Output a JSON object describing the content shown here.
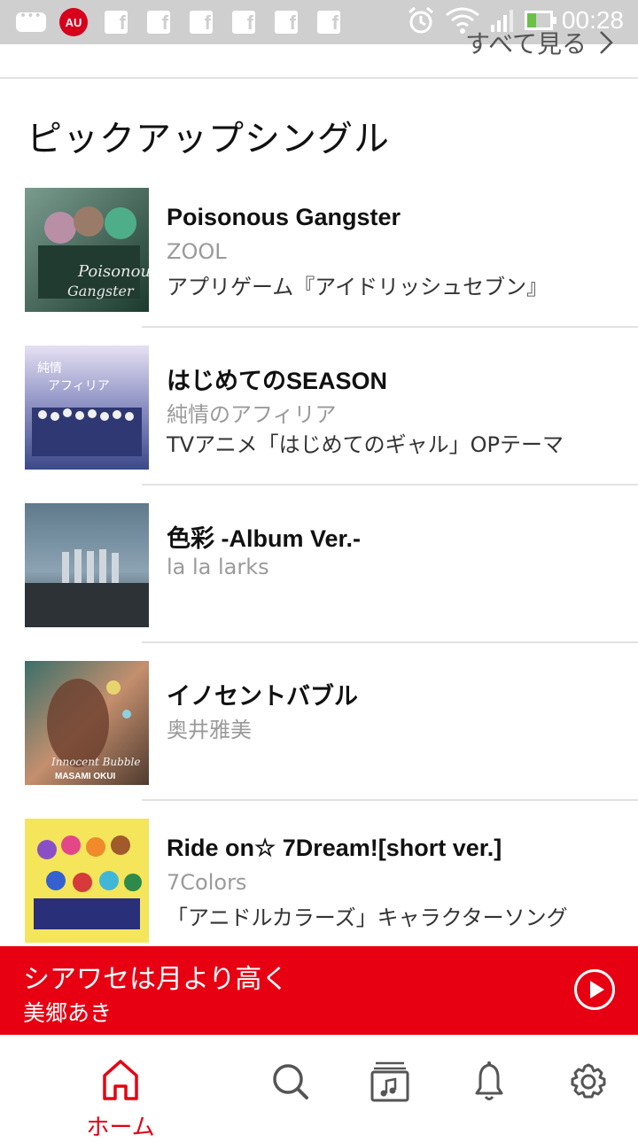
{
  "status_bar": {
    "time": "00:28",
    "notification_icons": [
      "chat-icon",
      "au-icon",
      "facebook-icon",
      "facebook-icon",
      "facebook-icon",
      "facebook-icon",
      "facebook-icon",
      "facebook-icon"
    ],
    "au_label": "AU"
  },
  "header": {
    "see_all_label": "すべて見る"
  },
  "section": {
    "title": "ピックアップシングル"
  },
  "singles": [
    {
      "title": "Poisonous Gangster",
      "artist": "ZOOL",
      "description": "アプリゲーム『アイドリッシュセブン』"
    },
    {
      "title": "はじめてのSEASON",
      "artist": "純情のアフィリア",
      "description": "TVアニメ「はじめてのギャル」OPテーマ"
    },
    {
      "title": "色彩 -Album Ver.-",
      "artist": "la la larks",
      "description": ""
    },
    {
      "title": "イノセントバブル",
      "artist": "奥井雅美",
      "description": ""
    },
    {
      "title": "Ride on☆ 7Dream![short ver.]",
      "artist": "7Colors",
      "description": "「アニドルカラーズ」キャラクターソング"
    }
  ],
  "player": {
    "title": "シアワセは月より高く",
    "artist": "美郷あき"
  },
  "bottom_nav": {
    "home_label": "ホーム"
  },
  "colors": {
    "accent": "#e60012",
    "status_bar": "#cfcfcf"
  }
}
